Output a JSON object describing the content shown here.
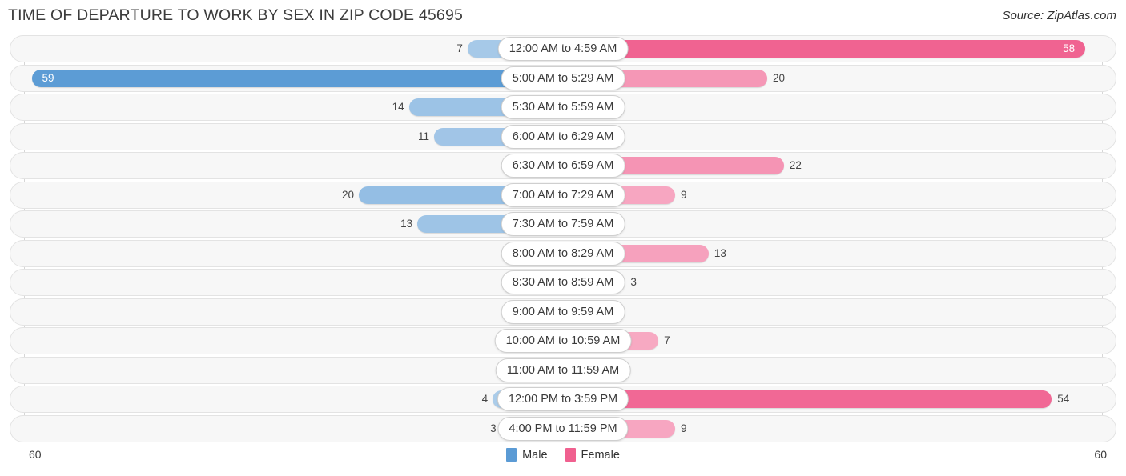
{
  "header": {
    "title": "TIME OF DEPARTURE TO WORK BY SEX IN ZIP CODE 45695",
    "source": "Source: ZipAtlas.com"
  },
  "legend": {
    "male_label": "Male",
    "female_label": "Female",
    "male_color": "#5b9bd5",
    "female_color": "#f0608f"
  },
  "axis": {
    "left_max": "60",
    "right_max": "60"
  },
  "chart_data": {
    "type": "bar",
    "title": "TIME OF DEPARTURE TO WORK BY SEX IN ZIP CODE 45695",
    "subtitle": "",
    "xlabel": "",
    "ylabel": "",
    "orientation": "horizontal-diverging",
    "grid": false,
    "legend_position": "bottom-center",
    "xlim": [
      60,
      60
    ],
    "axis_max": 60,
    "categories": [
      "12:00 AM to 4:59 AM",
      "5:00 AM to 5:29 AM",
      "5:30 AM to 5:59 AM",
      "6:00 AM to 6:29 AM",
      "6:30 AM to 6:59 AM",
      "7:00 AM to 7:29 AM",
      "7:30 AM to 7:59 AM",
      "8:00 AM to 8:29 AM",
      "8:30 AM to 8:59 AM",
      "9:00 AM to 9:59 AM",
      "10:00 AM to 10:59 AM",
      "11:00 AM to 11:59 AM",
      "12:00 PM to 3:59 PM",
      "4:00 PM to 11:59 PM"
    ],
    "series": [
      {
        "name": "Male",
        "color": "#5b9bd5",
        "values": [
          7,
          59,
          14,
          11,
          0,
          20,
          13,
          0,
          0,
          0,
          0,
          0,
          4,
          3
        ]
      },
      {
        "name": "Female",
        "color": "#f0608f",
        "values": [
          58,
          20,
          0,
          0,
          22,
          9,
          0,
          13,
          3,
          0,
          7,
          0,
          54,
          9
        ]
      }
    ]
  }
}
